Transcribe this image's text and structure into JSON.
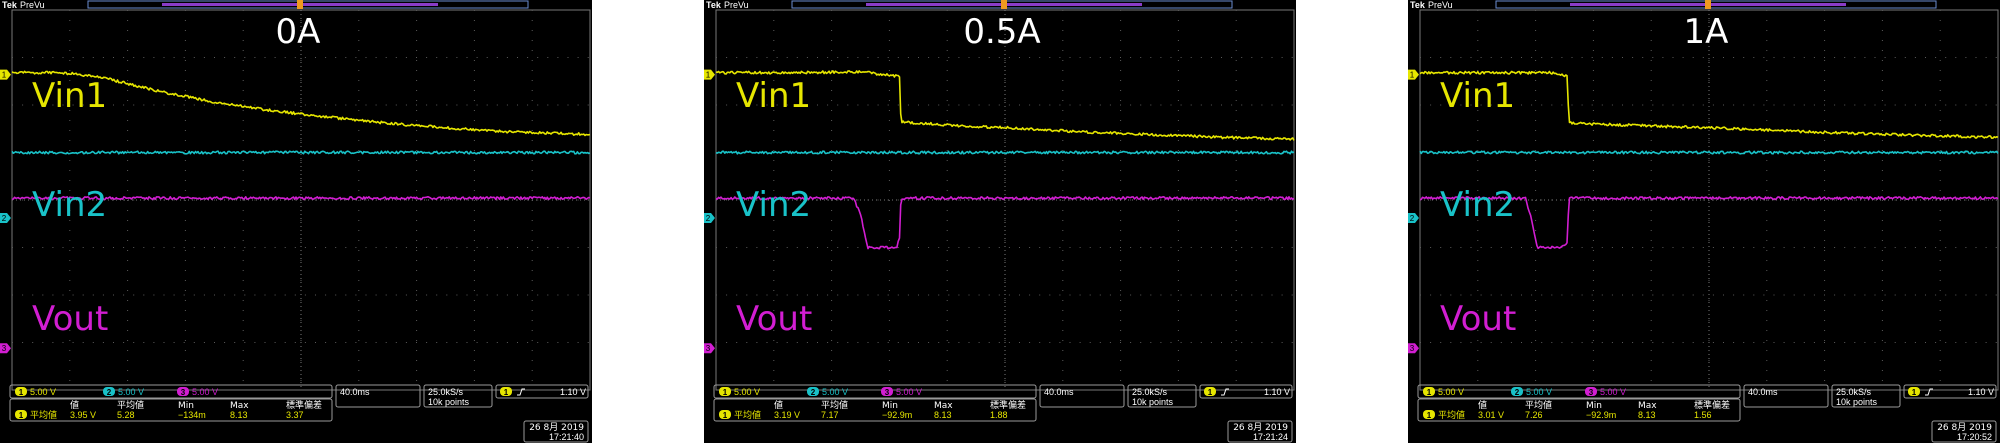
{
  "brand": "Tek",
  "mode": "PreVu",
  "colors": {
    "ch1": "#e6e600",
    "ch2": "#19c2c8",
    "ch3": "#d21ed2",
    "grid": "#5a5a5a",
    "text": "#ffffff"
  },
  "screens": [
    {
      "title": "0A",
      "labels": {
        "ch1": "Vin1",
        "ch2": "Vin2",
        "ch3": "Vout"
      },
      "status": {
        "ch1_scale": "5.00 V",
        "ch2_scale": "5.00 V",
        "ch3_scale": "5.00 V",
        "time_div": "40.0ms",
        "sample_rate": "25.0kS/s",
        "record": "10k points",
        "trigger_level": "1.10 V",
        "date": "26 8月 2019",
        "time": "17:21:40"
      },
      "measurement": {
        "headers": [
          "値",
          "平均値",
          "Min",
          "Max",
          "標準偏差"
        ],
        "label": "平均値",
        "values": [
          "3.95 V",
          "5.28",
          "−134m",
          "8.13",
          "3.37"
        ]
      }
    },
    {
      "title": "0.5A",
      "labels": {
        "ch1": "Vin1",
        "ch2": "Vin2",
        "ch3": "Vout"
      },
      "status": {
        "ch1_scale": "5.00 V",
        "ch2_scale": "5.00 V",
        "ch3_scale": "5.00 V",
        "time_div": "40.0ms",
        "sample_rate": "25.0kS/s",
        "record": "10k points",
        "trigger_level": "1.10 V",
        "date": "26 8月 2019",
        "time": "17:21:24"
      },
      "measurement": {
        "headers": [
          "値",
          "平均値",
          "Min",
          "Max",
          "標準偏差"
        ],
        "label": "平均値",
        "values": [
          "3.19 V",
          "7.17",
          "−92.9m",
          "8.13",
          "1.88"
        ]
      }
    },
    {
      "title": "1A",
      "labels": {
        "ch1": "Vin1",
        "ch2": "Vin2",
        "ch3": "Vout"
      },
      "status": {
        "ch1_scale": "5.00 V",
        "ch2_scale": "5.00 V",
        "ch3_scale": "5.00 V",
        "time_div": "40.0ms",
        "sample_rate": "25.0kS/s",
        "record": "10k points",
        "trigger_level": "1.10 V",
        "date": "26 8月 2019",
        "time": "17:20:52"
      },
      "measurement": {
        "headers": [
          "値",
          "平均値",
          "Min",
          "Max",
          "標準偏差"
        ],
        "label": "平均値",
        "values": [
          "3.01 V",
          "7.26",
          "−92.9m",
          "8.13",
          "1.56"
        ]
      }
    }
  ],
  "chart_data": [
    {
      "type": "line",
      "title": "0A",
      "x_unit": "ms",
      "y_unit": "V",
      "xlim": [
        -200,
        200
      ],
      "ylim": [
        -20,
        20
      ],
      "series": [
        {
          "name": "Vin1",
          "x": [
            -200,
            -165,
            -140,
            -100,
            -60,
            -20,
            20,
            60,
            100,
            140,
            200
          ],
          "y": [
            13.4,
            13.4,
            13.0,
            11.5,
            10.3,
            9.4,
            8.7,
            8.1,
            7.6,
            7.2,
            6.9
          ]
        },
        {
          "name": "Vin2",
          "x": [
            -200,
            200
          ],
          "y": [
            5.0,
            5.0
          ]
        },
        {
          "name": "Vout",
          "x": [
            -200,
            200
          ],
          "y": [
            0.2,
            0.2
          ]
        }
      ]
    },
    {
      "type": "line",
      "title": "0.5A",
      "x_unit": "ms",
      "y_unit": "V",
      "xlim": [
        -200,
        200
      ],
      "ylim": [
        -20,
        20
      ],
      "series": [
        {
          "name": "Vin1",
          "x": [
            -200,
            -150,
            -100,
            -73,
            -72,
            -40,
            0,
            50,
            100,
            150,
            200
          ],
          "y": [
            13.4,
            13.4,
            13.5,
            13.0,
            8.2,
            7.9,
            7.6,
            7.2,
            6.9,
            6.6,
            6.4
          ]
        },
        {
          "name": "Vout",
          "x": [
            -200,
            -105,
            -100,
            -95,
            -75,
            -73,
            -72,
            200
          ],
          "y": [
            0.2,
            0.2,
            -1.5,
            -5.0,
            -5.0,
            -4.0,
            0.2,
            0.2
          ]
        },
        {
          "name": "Vin2",
          "x": [
            -200,
            200
          ],
          "y": [
            5.0,
            5.0
          ]
        }
      ]
    },
    {
      "type": "line",
      "title": "1A",
      "x_unit": "ms",
      "y_unit": "V",
      "xlim": [
        -200,
        200
      ],
      "ylim": [
        -20,
        20
      ],
      "series": [
        {
          "name": "Vin1",
          "x": [
            -200,
            -150,
            -110,
            -98,
            -97,
            -60,
            0,
            50,
            100,
            150,
            200
          ],
          "y": [
            13.4,
            13.4,
            13.4,
            13.0,
            8.1,
            7.9,
            7.6,
            7.3,
            7.0,
            6.8,
            6.6
          ]
        },
        {
          "name": "Vout",
          "x": [
            -200,
            -127,
            -123,
            -119,
            -102,
            -98,
            -97,
            200
          ],
          "y": [
            0.2,
            0.2,
            -2.0,
            -5.0,
            -5.0,
            -4.5,
            0.2,
            0.2
          ]
        },
        {
          "name": "Vin2",
          "x": [
            -200,
            200
          ],
          "y": [
            5.0,
            5.0
          ]
        }
      ]
    }
  ]
}
